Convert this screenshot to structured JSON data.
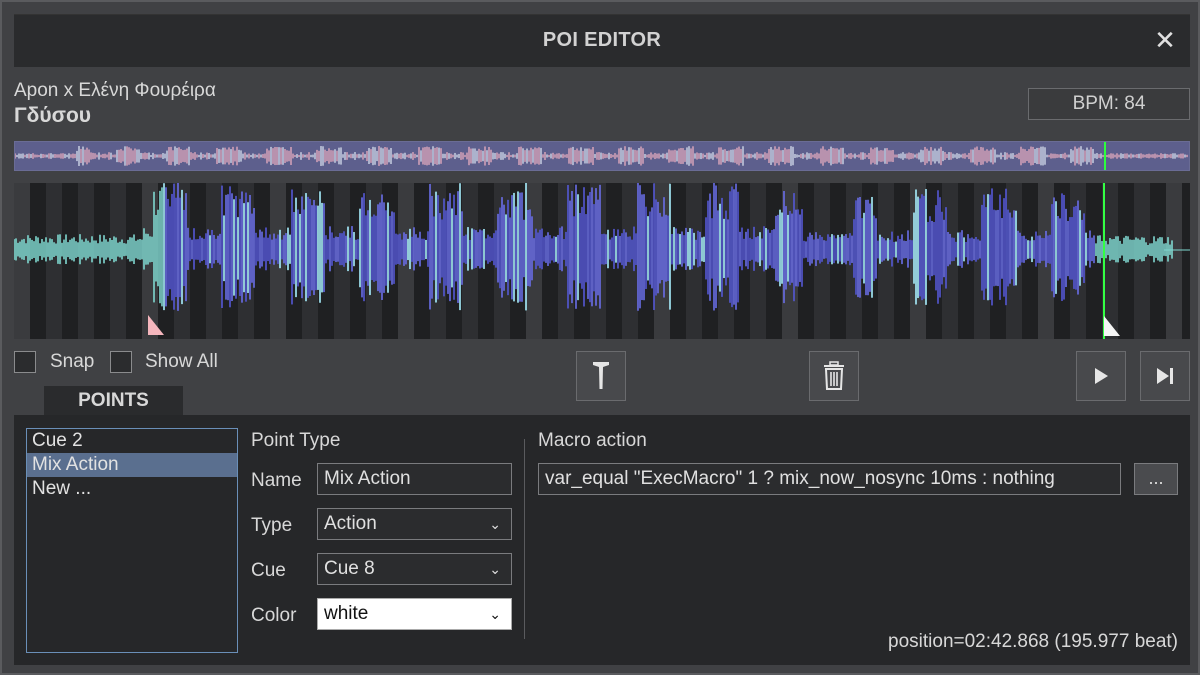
{
  "window": {
    "title": "POI EDITOR",
    "close_glyph": "✕"
  },
  "track": {
    "artist": "Apon x Ελένη Φουρέιρα",
    "title": "Γδύσου",
    "bpm_label": "BPM: 84"
  },
  "colors": {
    "cursor": "#33ff44",
    "list_selection": "#5a6f8f",
    "list_border": "#6a8fb8",
    "cue_marker": "#f5b6bd"
  },
  "options": {
    "snap_label": "Snap",
    "show_all_label": "Show All"
  },
  "toolbar": {
    "marker_icon": "marker-icon",
    "delete_icon": "trash-icon",
    "play_icon": "play-icon",
    "skip_icon": "skip-end-icon"
  },
  "tab": {
    "label": "POINTS"
  },
  "points": {
    "items": [
      "Cue 2",
      "Mix Action",
      "New ..."
    ],
    "selected_index": 1
  },
  "form": {
    "heading": "Point Type",
    "name_label": "Name",
    "name_value": "Mix Action",
    "type_label": "Type",
    "type_value": "Action",
    "cue_label": "Cue",
    "cue_value": "Cue 8",
    "color_label": "Color",
    "color_value": "white"
  },
  "macro": {
    "label": "Macro action",
    "value": "var_equal \"ExecMacro\" 1 ? mix_now_nosync 10ms : nothing",
    "browse_label": "..."
  },
  "status": {
    "position": "position=02:42.868 (195.977 beat)"
  }
}
